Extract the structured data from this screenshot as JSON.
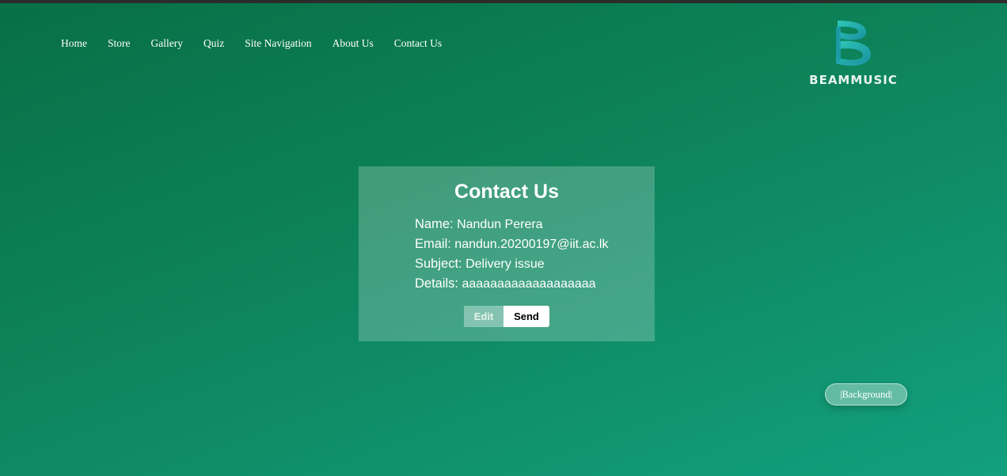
{
  "nav": {
    "items": [
      {
        "label": "Home"
      },
      {
        "label": "Store"
      },
      {
        "label": "Gallery"
      },
      {
        "label": "Quiz"
      },
      {
        "label": "Site Navigation"
      },
      {
        "label": "About Us"
      },
      {
        "label": "Contact Us"
      }
    ]
  },
  "logo": {
    "text": "BEAMMUSIC",
    "icon": "b-ribbon-logo-icon"
  },
  "contact": {
    "title": "Contact Us",
    "name_label": "Name:",
    "name_value": "Nandun Perera",
    "email_label": "Email:",
    "email_value": "nandun.20200197@iit.ac.lk",
    "subject_label": "Subject:",
    "subject_value": "Delivery issue",
    "details_label": "Details:",
    "details_value": "aaaaaaaaaaaaaaaaaaa",
    "edit_label": "Edit",
    "send_label": "Send"
  },
  "background_toggle": {
    "label": "|Background|"
  },
  "colors": {
    "background_start": "#086f46",
    "background_end": "#12a07e",
    "logo_accent": "#27b6a8"
  }
}
